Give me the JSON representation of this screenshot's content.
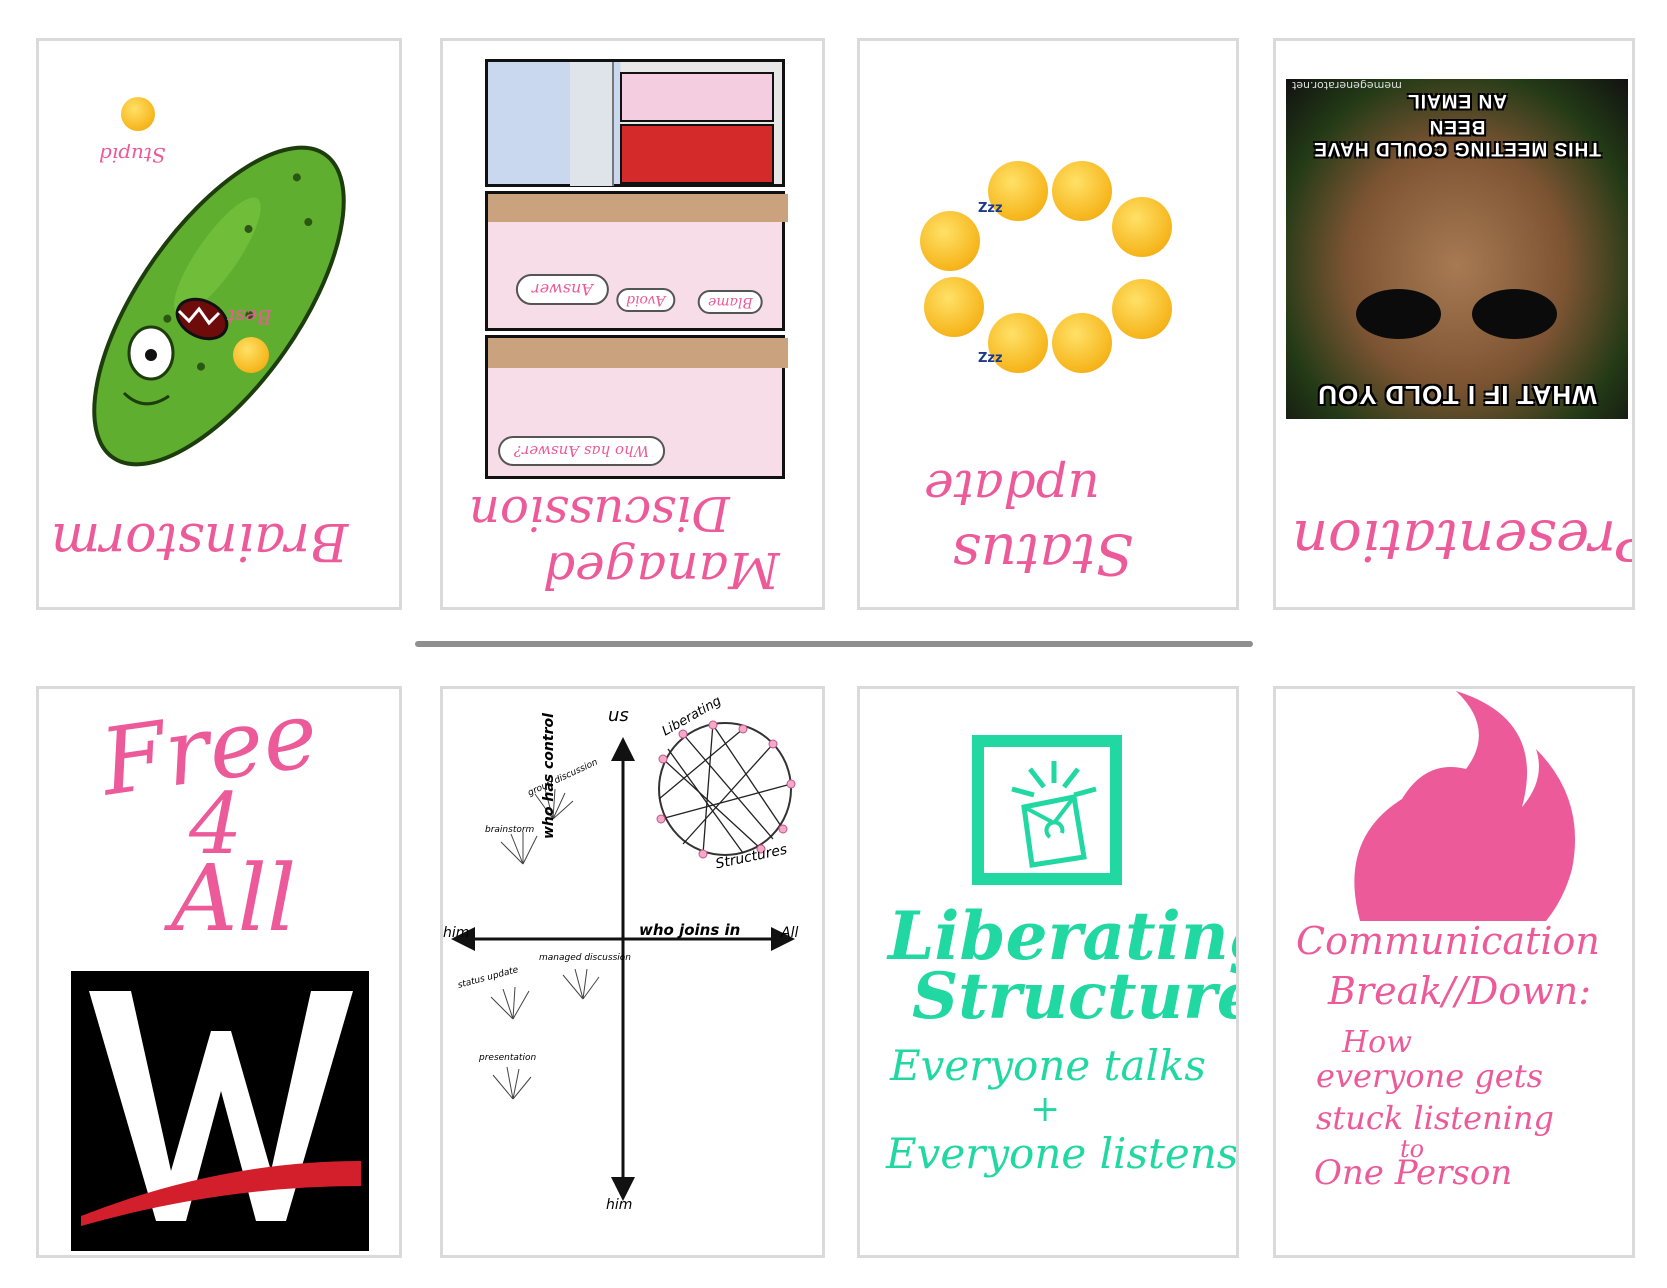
{
  "top_cards": {
    "brainstorm": {
      "title": "Brainstorm",
      "note_stupid": "Stupid",
      "note_best": "Best"
    },
    "managed": {
      "title_line1": "Managed",
      "title_line2": "Discussion",
      "bubble_answer": "Answer",
      "bubble_avoid": "Avoid",
      "bubble_blame": "Blame",
      "bubble_who": "Who has Answer?"
    },
    "status": {
      "title_line1": "Status",
      "title_line2": "update",
      "zzz1": "Zzz",
      "zzz2": "Zzz"
    },
    "presentation": {
      "title": "Presentation",
      "meme_top": "THIS MEETING COULD HAVE BEEN",
      "meme_top2": "AN EMAIL",
      "meme_bottom": "WHAT IF I TOLD YOU",
      "watermark": "memegenerator.net"
    }
  },
  "bottom_cards": {
    "free4all": {
      "line1": "Free",
      "line2": "4",
      "line3": "All",
      "logo_letter": "W"
    },
    "diagram": {
      "top_label": "us",
      "bottom_label": "him",
      "left_label": "him",
      "right_label": "All",
      "x_axis": "who joins in",
      "y_axis": "who has control",
      "liberating": "Liberating",
      "structures": "Structures",
      "group_discussion": "group discussion",
      "brainstorm": "brainstorm",
      "status_update": "status update",
      "managed_discussion": "managed discussion",
      "presentation": "presentation"
    },
    "liberating": {
      "title_line1": "Liberating",
      "title_line2": "Structures",
      "line1": "Everyone talks",
      "plus": "+",
      "line2": "Everyone listens"
    },
    "communication": {
      "line1": "Communication",
      "line2": "Break//Down:",
      "line3": "How",
      "line4": "everyone gets",
      "line5": "stuck listening",
      "line6": "to",
      "line7": "One Person"
    }
  },
  "colors": {
    "pink": "#ec5a99",
    "mint": "#22d8a2",
    "pickle": "#5fae30",
    "divider": "#8f8f8f"
  }
}
